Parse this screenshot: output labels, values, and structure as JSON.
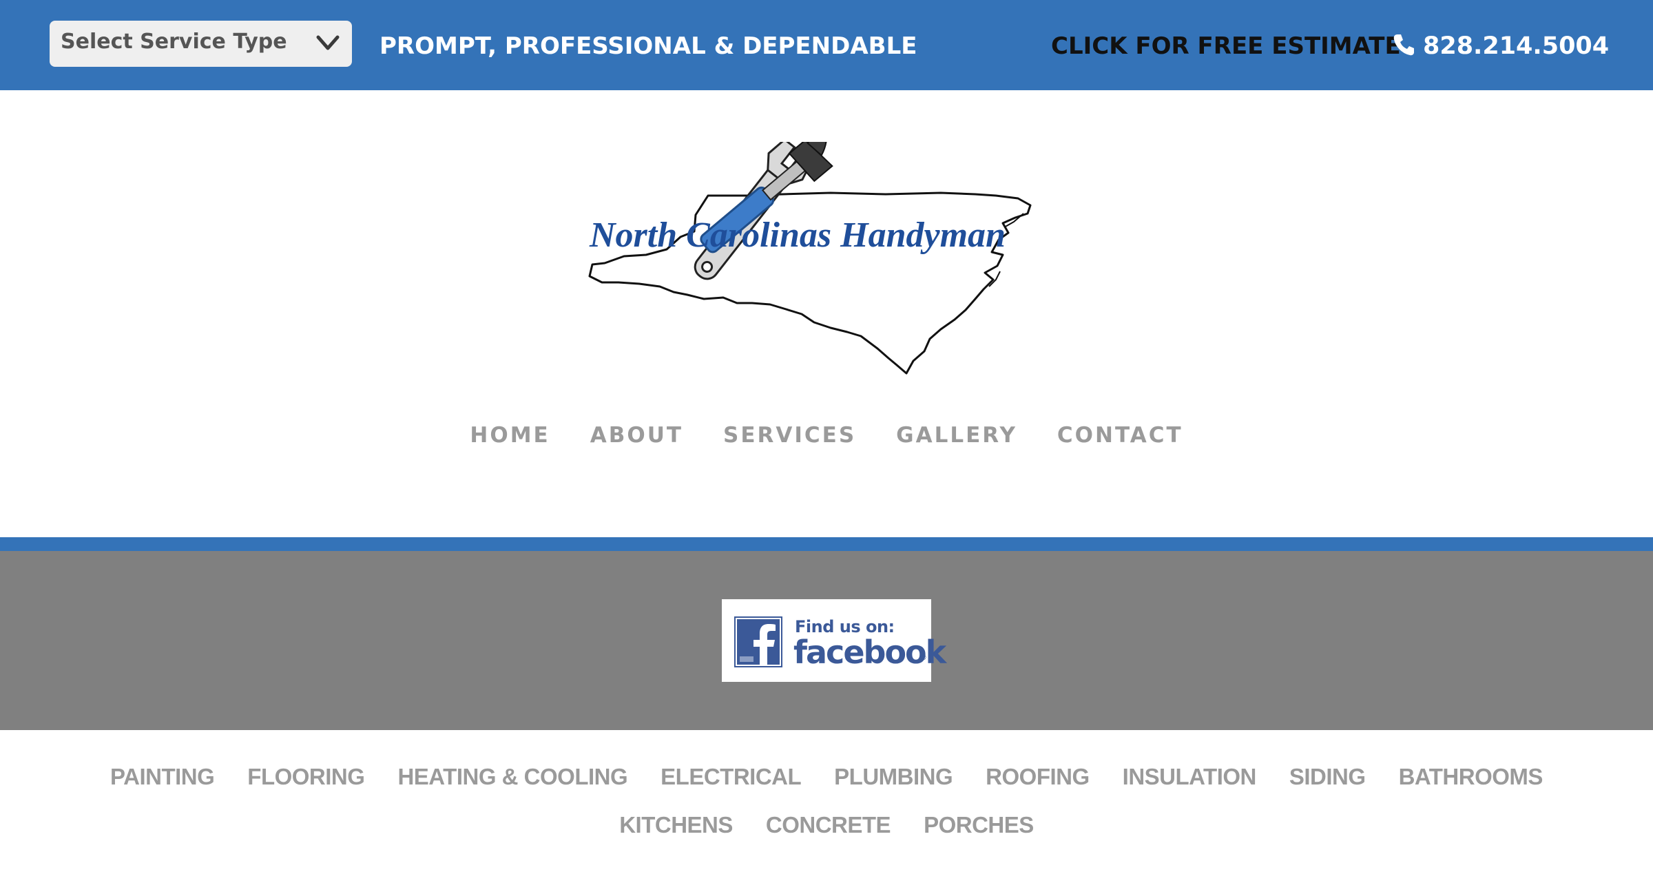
{
  "colors": {
    "brand_blue": "#3473b8",
    "band_gray": "#808080",
    "nav_gray": "#9a9a9a",
    "facebook_blue": "#3b5998"
  },
  "topbar": {
    "service_select": {
      "selected": "Select Service Type",
      "icon": "chevron-down-icon"
    },
    "tagline": "PROMPT, PROFESSIONAL & DEPENDABLE",
    "estimate_label": "CLICK FOR FREE ESTIMATE",
    "phone_icon": "phone-icon",
    "phone": "828.214.5004"
  },
  "logo": {
    "text": "North Carolinas Handyman"
  },
  "main_nav": {
    "items": [
      "HOME",
      "ABOUT",
      "SERVICES",
      "GALLERY",
      "CONTACT"
    ]
  },
  "facebook_badge": {
    "line1": "Find us on:",
    "line2": "facebook",
    "reg": "®",
    "icon": "facebook-icon"
  },
  "services_nav": {
    "items": [
      "PAINTING",
      "FLOORING",
      "HEATING & COOLING",
      "ELECTRICAL",
      "PLUMBING",
      "ROOFING",
      "INSULATION",
      "SIDING",
      "BATHROOMS",
      "KITCHENS",
      "CONCRETE",
      "PORCHES"
    ]
  }
}
